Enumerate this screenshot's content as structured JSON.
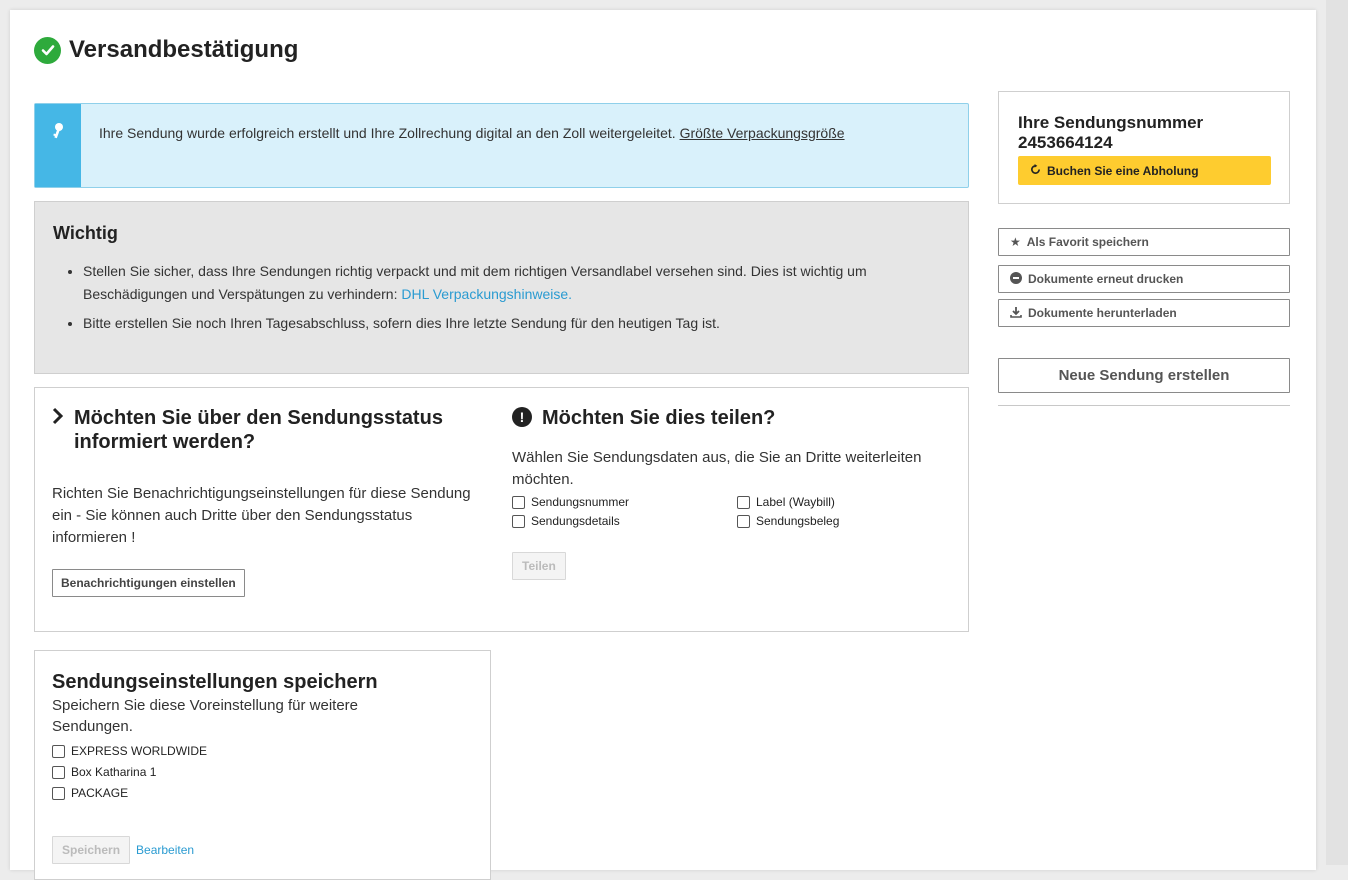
{
  "header": {
    "title": "Versandbestätigung"
  },
  "alert": {
    "text": "Ihre Sendung wurde erfolgreich erstellt und Ihre Zollrechung digital an den Zoll weitergeleitet.",
    "link": "Größte Verpackungsgröße"
  },
  "important": {
    "heading": "Wichtig",
    "item1_text": "Stellen Sie sicher, dass Ihre Sendungen richtig verpackt und mit dem richtigen Versandlabel versehen sind. Dies ist wichtig um Beschädigungen und Verspätungen zu verhindern:",
    "item1_link": "DHL Verpackungshinweise.",
    "item2_text": "Bitte erstellen Sie noch Ihren Tagesabschluss, sofern dies Ihre letzte Sendung für den heutigen Tag ist."
  },
  "notify": {
    "heading": "Möchten Sie über den Sendungsstatus informiert werden?",
    "desc": "Richten Sie Benachrichtigungseinstellungen für diese Sendung ein - Sie können auch Dritte über den Sendungsstatus informieren !",
    "button": "Benachrichtigungen einstellen"
  },
  "share": {
    "heading": "Möchten Sie dies teilen?",
    "desc": "Wählen Sie Sendungsdaten aus, die Sie an Dritte weiterleiten möchten.",
    "options": [
      "Sendungsnummer",
      "Label (Waybill)",
      "Sendungsdetails",
      "Sendungsbeleg"
    ],
    "button": "Teilen"
  },
  "save_settings": {
    "heading": "Sendungseinstellungen speichern",
    "desc": "Speichern Sie diese Voreinstellung für weitere Sendungen.",
    "options": [
      "EXPRESS WORLDWIDE",
      "Box Katharina 1",
      "PACKAGE"
    ],
    "save_button": "Speichern",
    "edit_link": "Bearbeiten"
  },
  "sidebar": {
    "tracking_label": "Ihre Sendungsnummer",
    "tracking_number": "2453664124",
    "pickup_button": "Buchen Sie eine Abholung",
    "favorite_button": "Als Favorit speichern",
    "reprint_button": "Dokumente erneut drucken",
    "download_button": "Dokumente herunterladen",
    "new_shipment_button": "Neue Sendung erstellen"
  },
  "colors": {
    "success": "#2eaa3c",
    "info": "#45b7e6",
    "accent_yellow": "#fecc2f",
    "link": "#2a9bd1"
  },
  "icons": [
    "check-circle-icon",
    "key-icon",
    "chevron-right-icon",
    "exclamation-circle-icon",
    "refresh-icon",
    "star-icon",
    "minus-circle-icon",
    "download-icon"
  ]
}
